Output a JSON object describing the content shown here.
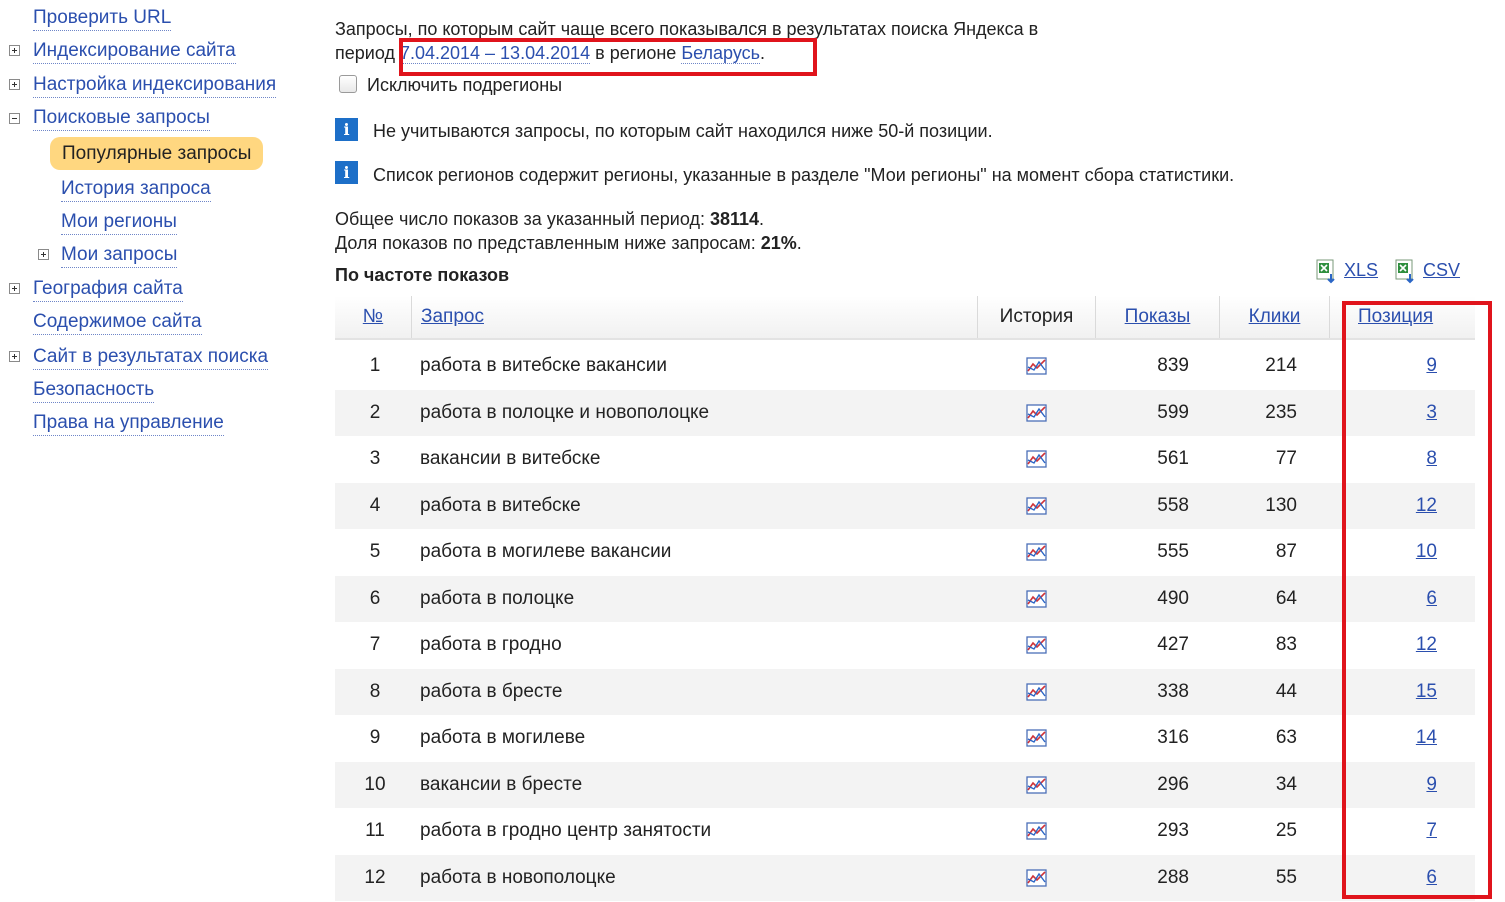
{
  "sidebar": {
    "items": [
      {
        "label": "Проверить URL"
      },
      {
        "label": "Индексирование сайта"
      },
      {
        "label": "Настройка индексирования"
      },
      {
        "label": "Поисковые запросы"
      },
      {
        "label": "Популярные запросы"
      },
      {
        "label": "История запроса"
      },
      {
        "label": "Мои регионы"
      },
      {
        "label": "Мои запросы"
      },
      {
        "label": "География сайта"
      },
      {
        "label": "Содержимое сайта"
      },
      {
        "label": "Сайт в результатах поиска"
      },
      {
        "label": "Безопасность"
      },
      {
        "label": "Права на управление"
      }
    ]
  },
  "header": {
    "line1": "Запросы, по которым сайт чаще всего показывался в результатах поиска Яндекса в",
    "period_prefix": "период ",
    "period_link": "7.04.2014 – 13.04.2014",
    "region_prefix": " в регионе ",
    "region_link": "Беларусь",
    "period_suffix": "."
  },
  "exclude_subregions": {
    "label": "Исключить подрегионы",
    "checked": false
  },
  "notices": [
    "Не учитываются запросы, по которым сайт находился ниже 50-й позиции.",
    "Список регионов содержит регионы, указанные в разделе \"Мои регионы\" на момент сбора статистики."
  ],
  "stats": {
    "total_label": "Общее число показов за указанный период: ",
    "total_value": "38114",
    "total_suffix": ".",
    "share_label": "Доля показов по представленным ниже запросам: ",
    "share_value": "21%",
    "share_suffix": "."
  },
  "section_title": "По частоте показов",
  "export": {
    "xls": "XLS",
    "csv": "CSV"
  },
  "table": {
    "headers": {
      "num": "№",
      "query": "Запрос",
      "history": "История",
      "shows": "Показы",
      "clicks": "Клики",
      "position": "Позиция"
    },
    "rows": [
      {
        "num": "1",
        "query": "работа в витебске вакансии",
        "shows": "839",
        "clicks": "214",
        "position": "9"
      },
      {
        "num": "2",
        "query": "работа в полоцке и новополоцке",
        "shows": "599",
        "clicks": "235",
        "position": "3"
      },
      {
        "num": "3",
        "query": "вакансии в витебске",
        "shows": "561",
        "clicks": "77",
        "position": "8"
      },
      {
        "num": "4",
        "query": "работа в витебске",
        "shows": "558",
        "clicks": "130",
        "position": "12"
      },
      {
        "num": "5",
        "query": "работа в могилеве вакансии",
        "shows": "555",
        "clicks": "87",
        "position": "10"
      },
      {
        "num": "6",
        "query": "работа в полоцке",
        "shows": "490",
        "clicks": "64",
        "position": "6"
      },
      {
        "num": "7",
        "query": "работа в гродно",
        "shows": "427",
        "clicks": "83",
        "position": "12"
      },
      {
        "num": "8",
        "query": "работа в бресте",
        "shows": "338",
        "clicks": "44",
        "position": "15"
      },
      {
        "num": "9",
        "query": "работа в могилеве",
        "shows": "316",
        "clicks": "63",
        "position": "14"
      },
      {
        "num": "10",
        "query": "вакансии в бресте",
        "shows": "296",
        "clicks": "34",
        "position": "9"
      },
      {
        "num": "11",
        "query": "работа в гродно центр занятости",
        "shows": "293",
        "clicks": "25",
        "position": "7"
      },
      {
        "num": "12",
        "query": "работа в новополоцке",
        "shows": "288",
        "clicks": "55",
        "position": "6"
      }
    ]
  },
  "colors": {
    "link": "#2b4fae",
    "highlight": "#e0141c",
    "active_nav": "#ffd780",
    "info": "#1d6fc8"
  }
}
